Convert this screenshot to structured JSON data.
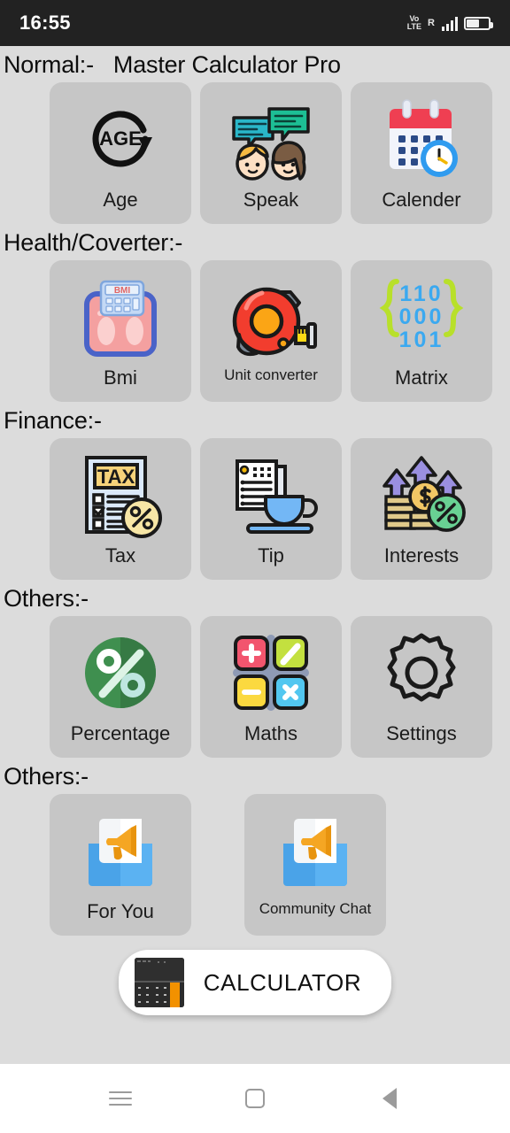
{
  "status_bar": {
    "time": "16:55",
    "volte_top": "Vo",
    "volte_bottom": "LTE",
    "roaming": "R",
    "signal_bars": 4,
    "battery_percent": 52
  },
  "header": {
    "section_label": "Normal:-",
    "app_title": "Master Calculator Pro"
  },
  "sections": [
    {
      "label": "Normal:-",
      "tiles": [
        {
          "label": "Age",
          "icon": "age-rotate-icon"
        },
        {
          "label": "Speak",
          "icon": "speech-bubbles-people-icon"
        },
        {
          "label": "Calender",
          "icon": "calendar-clock-icon"
        }
      ]
    },
    {
      "label": "Health/Coverter:-",
      "tiles": [
        {
          "label": "Bmi",
          "icon": "bmi-scale-icon"
        },
        {
          "label": "Unit converter",
          "icon": "tape-measure-icon"
        },
        {
          "label": "Matrix",
          "icon": "matrix-binary-icon"
        }
      ]
    },
    {
      "label": "Finance:-",
      "tiles": [
        {
          "label": "Tax",
          "icon": "tax-document-percent-icon"
        },
        {
          "label": "Tip",
          "icon": "bill-coffee-cup-icon"
        },
        {
          "label": "Interests",
          "icon": "coins-arrows-growth-icon"
        }
      ]
    },
    {
      "label": "Others:-",
      "tiles": [
        {
          "label": "Percentage",
          "icon": "percent-circle-icon"
        },
        {
          "label": "Maths",
          "icon": "math-operators-grid-icon"
        },
        {
          "label": "Settings",
          "icon": "gear-icon"
        }
      ]
    },
    {
      "label": "Others:-",
      "tiles": [
        {
          "label": "For You",
          "icon": "envelope-megaphone-icon"
        },
        {
          "label": "Community Chat",
          "icon": "envelope-megaphone-icon"
        }
      ]
    }
  ],
  "matrix_icon": {
    "rows": [
      "110",
      "000",
      "101"
    ],
    "bracket_color": "#b8e02a",
    "digit_color": "#3ba9f0"
  },
  "age_icon": {
    "text": "AGE"
  },
  "bmi_icon": {
    "text": "BMI"
  },
  "tax_icon": {
    "text": "TAX"
  },
  "calculator_button": {
    "label": "CALCULATOR",
    "thumb_accent": "#f29100",
    "thumb_background": "#2b2b2b"
  },
  "nav_bar": {
    "recents": "recents-menu-icon",
    "home": "home-square-icon",
    "back": "back-triangle-icon"
  },
  "colors": {
    "page_background": "#dcdcdc",
    "tile_background": "#c6c6c6",
    "status_bar": "#222222",
    "nav_bar": "#ffffff",
    "text": "#1b1b1b"
  }
}
